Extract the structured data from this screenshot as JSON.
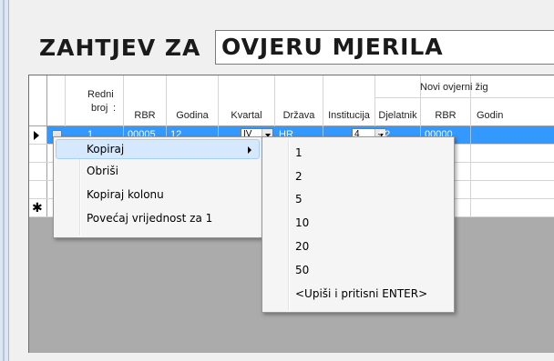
{
  "title": {
    "left": "ZAHTJEV ZA",
    "right": "OVJERU MJERILA"
  },
  "grid": {
    "group_header": "Novi ovjerni žig",
    "columns": [
      {
        "line1": "Redni",
        "line2": "broj"
      },
      {
        "label": "RBR"
      },
      {
        "label": "Godina"
      },
      {
        "label": "Kvartal"
      },
      {
        "label": "Država"
      },
      {
        "label": "Institucija"
      },
      {
        "label": "Djelatnik"
      },
      {
        "label": "RBR"
      },
      {
        "label": "Godin"
      }
    ],
    "rows": [
      {
        "redni": "1",
        "rbr": "00005",
        "godina": "12",
        "kvartal": "IV",
        "drzava": "HR",
        "institucija": "4",
        "djelatnik": "02",
        "rbr2": "00000"
      },
      {
        "rbr2": "0000"
      },
      {
        "rbr2": "0000"
      },
      {
        "rbr2": "0000"
      }
    ]
  },
  "context_menu": {
    "items": [
      {
        "label": "Kopiraj",
        "has_submenu": true,
        "highlighted": true
      },
      {
        "label": "Obriši"
      },
      {
        "label": "Kopiraj kolonu"
      },
      {
        "label": "Povećaj vrijednost za 1"
      }
    ]
  },
  "submenu": {
    "items": [
      "1",
      "2",
      "5",
      "10",
      "20",
      "50",
      "<Upiši i pritisni ENTER>"
    ]
  }
}
